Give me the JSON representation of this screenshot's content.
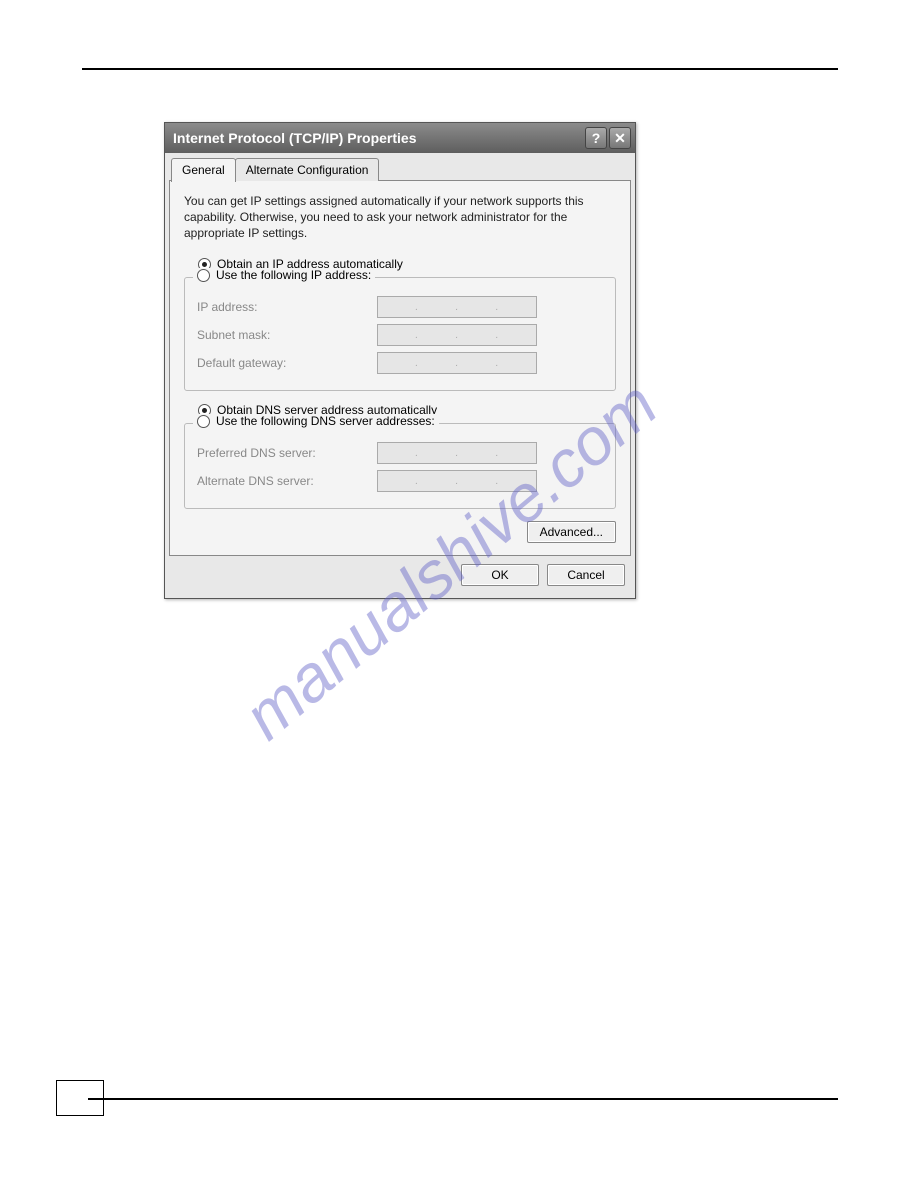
{
  "watermark": "manualshive.com",
  "dialog": {
    "title": "Internet Protocol (TCP/IP) Properties",
    "help_icon": "?",
    "close_icon": "✕",
    "tabs": {
      "general": "General",
      "alternate": "Alternate Configuration"
    },
    "intro": "You can get IP settings assigned automatically if your network supports this capability. Otherwise, you need to ask your network administrator for the appropriate IP settings.",
    "ip": {
      "auto": "Obtain an IP address automatically",
      "manual": "Use the following IP address:",
      "ip_label": "IP address:",
      "subnet_label": "Subnet mask:",
      "gateway_label": "Default gateway:"
    },
    "dns": {
      "auto": "Obtain DNS server address automatically",
      "manual": "Use the following DNS server addresses:",
      "preferred_label": "Preferred DNS server:",
      "alternate_label": "Alternate DNS server:"
    },
    "advanced": "Advanced...",
    "ok": "OK",
    "cancel": "Cancel"
  }
}
